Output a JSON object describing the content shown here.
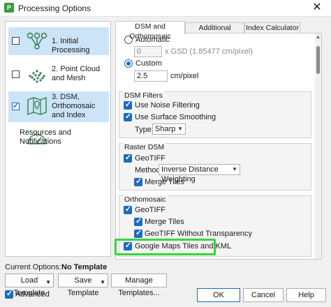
{
  "window": {
    "title": "Processing Options",
    "close_glyph": "✕",
    "app_icon_glyph": "P"
  },
  "nav": [
    {
      "label": "1. Initial Processing",
      "checked": false,
      "selected": true,
      "icon": "initial-processing-icon"
    },
    {
      "label": "2. Point Cloud and Mesh",
      "checked": false,
      "selected": false,
      "icon": "point-cloud-icon"
    },
    {
      "label": "3. DSM, Orthomosaic and Index",
      "checked": true,
      "selected": true,
      "icon": "dsm-map-icon"
    },
    {
      "label": "Resources and Notifications",
      "checked": null,
      "selected": false,
      "icon": "gauge-icon"
    }
  ],
  "tabs": [
    {
      "label": "DSM and Orthomosaic",
      "active": true
    },
    {
      "label": "Additional Outputs",
      "active": false
    },
    {
      "label": "Index Calculator",
      "active": false
    }
  ],
  "resolution": {
    "automatic_label": "Automatic",
    "automatic_value": "0",
    "automatic_unit": "x GSD (1.85477 cm/pixel)",
    "custom_label": "Custom",
    "custom_value": "2.5",
    "custom_unit": "cm/pixel",
    "selected": "Custom"
  },
  "dsm_filters": {
    "title": "DSM Filters",
    "noise_filtering": "Use Noise Filtering",
    "surface_smoothing": "Use Surface Smoothing",
    "type_label": "Type:",
    "type_value": "Sharp"
  },
  "raster_dsm": {
    "title": "Raster DSM",
    "geotiff": "GeoTIFF",
    "method_label": "Method:",
    "method_value": "Inverse Distance Weighting",
    "merge_tiles": "Merge Tiles"
  },
  "orthomosaic": {
    "title": "Orthomosaic",
    "geotiff": "GeoTIFF",
    "merge_tiles": "Merge Tiles",
    "without_transparency": "GeoTIFF Without Transparency",
    "google_maps": "Google Maps Tiles and KML"
  },
  "footer": {
    "current_options_label": "Current Options:",
    "current_options_value": "No Template",
    "load_template": "Load Template",
    "save_template": "Save Template",
    "manage_templates": "Manage Templates...",
    "advanced": "Advanced",
    "ok": "OK",
    "cancel": "Cancel",
    "help": "Help"
  },
  "colors": {
    "highlight": "#39d439",
    "accent": "#1e6bbf",
    "selection": "#cce4f7"
  }
}
